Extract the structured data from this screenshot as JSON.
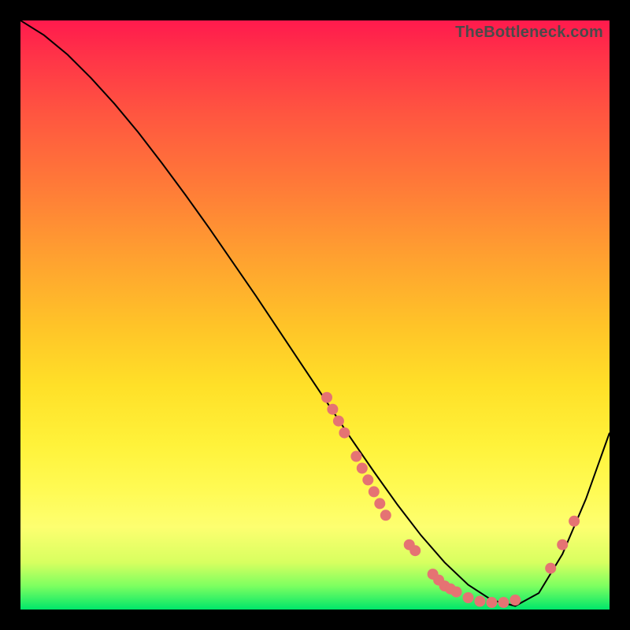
{
  "watermark": "TheBottleneck.com",
  "chart_data": {
    "type": "line",
    "title": "",
    "xlabel": "",
    "ylabel": "",
    "xlim": [
      0,
      100
    ],
    "ylim": [
      0,
      100
    ],
    "curve": {
      "x": [
        0,
        4,
        8,
        12,
        16,
        20,
        24,
        28,
        32,
        36,
        40,
        44,
        48,
        52,
        56,
        60,
        64,
        68,
        72,
        76,
        80,
        84,
        88,
        92,
        96,
        100
      ],
      "y": [
        100,
        97.5,
        94.2,
        90.2,
        85.8,
        81.0,
        75.8,
        70.4,
        64.8,
        59.0,
        53.2,
        47.2,
        41.2,
        35.2,
        29.2,
        23.4,
        17.8,
        12.6,
        8.0,
        4.2,
        1.6,
        0.6,
        2.8,
        9.4,
        18.8,
        30.0
      ]
    },
    "points": [
      {
        "x": 52,
        "y": 36
      },
      {
        "x": 53,
        "y": 34
      },
      {
        "x": 54,
        "y": 32
      },
      {
        "x": 55,
        "y": 30
      },
      {
        "x": 57,
        "y": 26
      },
      {
        "x": 58,
        "y": 24
      },
      {
        "x": 59,
        "y": 22
      },
      {
        "x": 60,
        "y": 20
      },
      {
        "x": 61,
        "y": 18
      },
      {
        "x": 62,
        "y": 16
      },
      {
        "x": 66,
        "y": 11
      },
      {
        "x": 67,
        "y": 10
      },
      {
        "x": 70,
        "y": 6
      },
      {
        "x": 71,
        "y": 5
      },
      {
        "x": 72,
        "y": 4
      },
      {
        "x": 73,
        "y": 3.5
      },
      {
        "x": 74,
        "y": 3
      },
      {
        "x": 76,
        "y": 2
      },
      {
        "x": 78,
        "y": 1.4
      },
      {
        "x": 80,
        "y": 1.2
      },
      {
        "x": 82,
        "y": 1.2
      },
      {
        "x": 84,
        "y": 1.6
      },
      {
        "x": 90,
        "y": 7
      },
      {
        "x": 92,
        "y": 11
      },
      {
        "x": 94,
        "y": 15
      }
    ],
    "colors": {
      "curve": "#000000",
      "dots": "#e57373",
      "gradient_top": "#ff1a4d",
      "gradient_bottom": "#00e66a"
    }
  }
}
